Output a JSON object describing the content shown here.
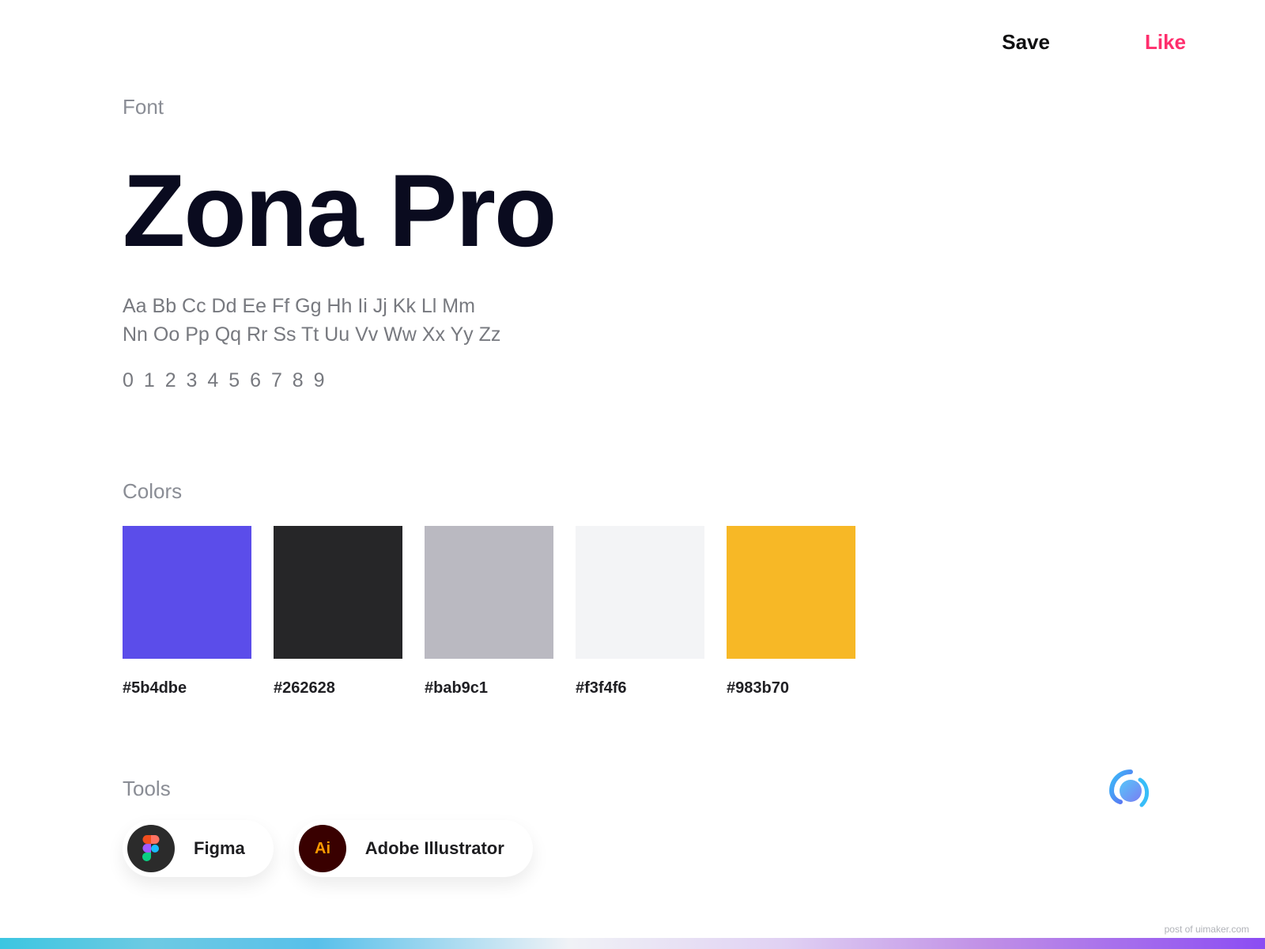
{
  "topbar": {
    "save_label": "Save",
    "like_label": "Like"
  },
  "font": {
    "section_label": "Font",
    "title": "Zona Pro",
    "specimen_line1": "Aa Bb Cc Dd Ee Ff Gg Hh Ii Jj Kk Ll Mm",
    "specimen_line2": "Nn Oo Pp Qq Rr Ss Tt Uu Vv Ww Xx Yy Zz",
    "numbers": "0 1 2 3 4 5 6 7 8 9"
  },
  "colors": {
    "section_label": "Colors",
    "items": [
      {
        "hex": "#5b4dbe",
        "swatch": "#5b4dea"
      },
      {
        "hex": "#262628",
        "swatch": "#262628"
      },
      {
        "hex": "#bab9c1",
        "swatch": "#bab9c1"
      },
      {
        "hex": "#f3f4f6",
        "swatch": "#f3f4f6"
      },
      {
        "hex": "#983b70",
        "swatch": "#f7b826"
      }
    ]
  },
  "tools": {
    "section_label": "Tools",
    "items": [
      {
        "name": "Figma"
      },
      {
        "name": "Adobe Illustrator"
      }
    ]
  },
  "watermark": "post of uimaker.com"
}
